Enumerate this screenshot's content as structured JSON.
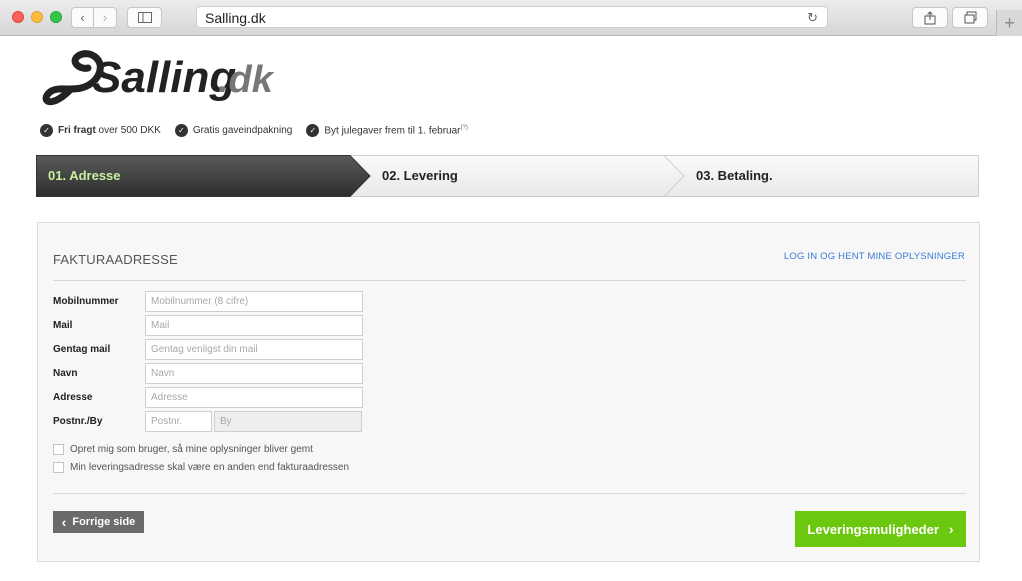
{
  "browser": {
    "url": "Salling.dk",
    "reload_icon": "reload-icon",
    "back_icon": "chevron-left-icon",
    "forward_icon": "chevron-right-icon",
    "share_icon": "share-icon",
    "tabs_icon": "tabs-icon",
    "newtab_label": "+"
  },
  "logo": {
    "text_main": "Salling",
    "text_suffix": ".dk"
  },
  "usps": [
    {
      "bold": "Fri fragt",
      "text": " over 500 DKK",
      "sup": ""
    },
    {
      "bold": "",
      "text": "Gratis gaveindpakning",
      "sup": ""
    },
    {
      "bold": "",
      "text": "Byt julegaver frem til 1. februar",
      "sup": "(?)"
    }
  ],
  "steps": [
    {
      "label": "01. Adresse",
      "active": true
    },
    {
      "label": "02. Levering",
      "active": false
    },
    {
      "label": "03. Betaling.",
      "active": false
    }
  ],
  "form": {
    "title": "FAKTURAADRESSE",
    "login_link": "LOG IN OG HENT MINE OPLYSNINGER",
    "fields": [
      {
        "label": "Mobilnummer",
        "placeholder": "Mobilnummer (8 cifre)"
      },
      {
        "label": "Mail",
        "placeholder": "Mail"
      },
      {
        "label": "Gentag mail",
        "placeholder": "Gentag venligst din mail"
      },
      {
        "label": "Navn",
        "placeholder": "Navn"
      },
      {
        "label": "Adresse",
        "placeholder": "Adresse"
      },
      {
        "label": "Postnr./By",
        "placeholder": "Postnr.",
        "placeholder2": "By"
      }
    ],
    "checkboxes": [
      "Opret mig som bruger, så mine oplysninger bliver gemt",
      "Min leveringsadresse skal være en anden end fakturaadressen"
    ],
    "prev_label": "Forrige side",
    "next_label": "Leveringsmuligheder"
  },
  "colors": {
    "accent_green": "#6cc70f",
    "step_active_bg": "#4a4a4a",
    "link_blue": "#3a7bd5"
  }
}
